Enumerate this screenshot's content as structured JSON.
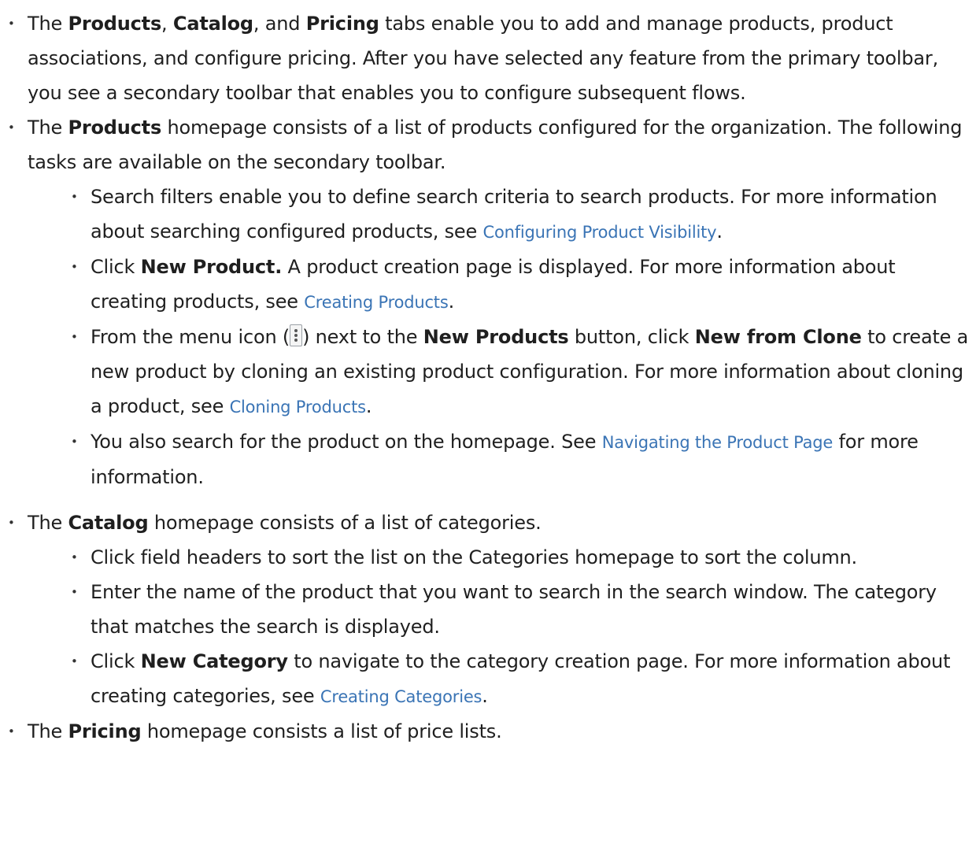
{
  "bullet1": {
    "p1": "The ",
    "b1": "Products",
    "p2": ", ",
    "b2": "Catalog",
    "p3": ", and ",
    "b3": "Pricing",
    "p4": " tabs enable you to add and manage products, product associations, and configure pricing. After you have selected any feature from the primary toolbar, you see a secondary toolbar that enables you to configure subsequent flows."
  },
  "bullet2": {
    "p1": "The ",
    "b1": "Products",
    "p2": " homepage consists of a list of products configured for the organization. The following tasks are available on the secondary toolbar.",
    "sub": [
      {
        "p1": "Search filters enable you to define search criteria to search products. For more information about searching configured products, see ",
        "link": "Configuring Product Visibility",
        "p2": "."
      },
      {
        "p1": "Click ",
        "b1": "New Product.",
        "p2": " A product creation page is displayed. For more information about creating products, see ",
        "link": "Creating Products",
        "p3": "."
      },
      {
        "p1": "From the menu icon (",
        "icon": "vertical-ellipsis-menu-icon",
        "p2": ") next to the ",
        "b1": "New Products",
        "p3": " button, click ",
        "b2": "New from Clone",
        "p4": " to create a new product by cloning an existing product configuration. For more information about cloning a product, see ",
        "link": "Cloning Products",
        "p5": "."
      },
      {
        "p1": "You also search for the product on the homepage. See ",
        "link": "Navigating the Product Page",
        "p2": " for more information."
      }
    ]
  },
  "bullet3": {
    "p1": "The ",
    "b1": "Catalog",
    "p2": " homepage consists of a list of categories.",
    "sub": [
      {
        "text": "Click field headers to sort the list on the Categories homepage to sort the column."
      },
      {
        "text": "Enter the name of the product that you want to search in the search window. The category that matches the search is displayed."
      },
      {
        "p1": "Click ",
        "b1": "New Category",
        "p2": " to navigate to the category creation page. For more information about creating categories, see ",
        "link": "Creating Categories",
        "p3": "."
      }
    ]
  },
  "bullet4": {
    "p1": "The ",
    "b1": "Pricing",
    "p2": " homepage consists a list of price lists."
  },
  "colors": {
    "text": "#1f1f1f",
    "link": "#3a74b5"
  }
}
